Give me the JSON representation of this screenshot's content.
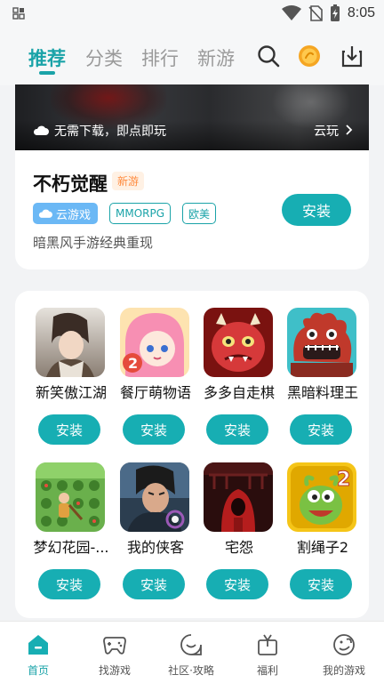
{
  "status_bar": {
    "time": "8:05"
  },
  "top_nav": {
    "tabs": [
      {
        "label": "推荐",
        "active": true
      },
      {
        "label": "分类",
        "active": false
      },
      {
        "label": "排行",
        "active": false
      },
      {
        "label": "新游",
        "active": false
      }
    ],
    "icons": [
      "search-icon",
      "coin-icon",
      "download-icon"
    ]
  },
  "featured": {
    "banner_text": "无需下载，即点即玩",
    "banner_action": "云玩",
    "game_name": "不朽觉醒",
    "badge": "新游",
    "tags": [
      "云游戏",
      "MMORPG",
      "欧美"
    ],
    "description": "暗黑风手游经典重现",
    "install_label": "安装"
  },
  "game_grid": [
    {
      "name": "新笑傲江湖",
      "install_label": "安装",
      "icon": "wuxia-swordsman-icon"
    },
    {
      "name": "餐厅萌物语",
      "install_label": "安装",
      "icon": "anime-girl-icon"
    },
    {
      "name": "多多自走棋",
      "install_label": "安装",
      "icon": "red-dragon-icon"
    },
    {
      "name": "黑暗料理王",
      "install_label": "安装",
      "icon": "octopus-monster-icon"
    },
    {
      "name": "梦幻花园-...",
      "install_label": "安装",
      "icon": "garden-farmer-icon"
    },
    {
      "name": "我的侠客",
      "install_label": "安装",
      "icon": "swordsman-portrait-icon"
    },
    {
      "name": "宅怨",
      "install_label": "安装",
      "icon": "red-hood-horror-icon"
    },
    {
      "name": "割绳子2",
      "install_label": "安装",
      "icon": "om-nom-icon"
    }
  ],
  "bottom_nav": [
    {
      "label": "首页",
      "active": true,
      "icon": "home-icon"
    },
    {
      "label": "找游戏",
      "active": false,
      "icon": "gamepad-icon"
    },
    {
      "label": "社区·攻略",
      "active": false,
      "icon": "community-icon"
    },
    {
      "label": "福利",
      "active": false,
      "icon": "gift-icon"
    },
    {
      "label": "我的游戏",
      "active": false,
      "icon": "my-games-icon"
    }
  ],
  "colors": {
    "accent": "#17aeb3",
    "badge_orange": "#ff8a3d",
    "cloud_tag_blue": "#6bb8f5"
  }
}
